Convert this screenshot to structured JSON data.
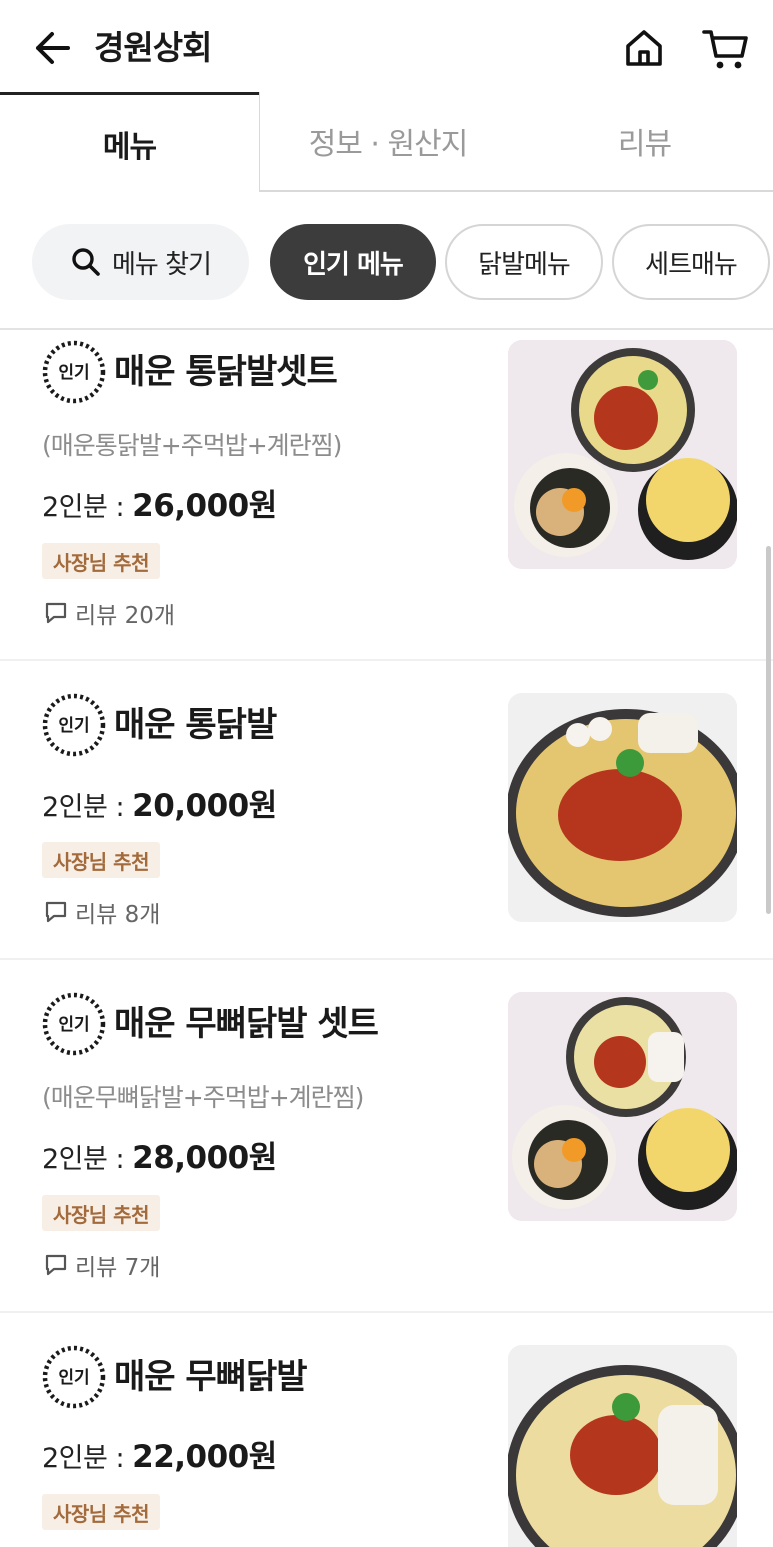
{
  "header": {
    "title": "경원상회",
    "back_icon": "arrow-left-icon",
    "home_icon": "home-icon",
    "cart_icon": "cart-icon"
  },
  "tabs": [
    {
      "label": "메뉴",
      "active": true
    },
    {
      "label": "정보 · 원산지",
      "active": false
    },
    {
      "label": "리뷰",
      "active": false
    }
  ],
  "chips": {
    "search_label": "메뉴 찾기",
    "popular_label": "인기 메뉴",
    "feet_label": "닭발메뉴",
    "set_label": "세트매뉴"
  },
  "badge_text": "인기",
  "items": [
    {
      "name": "매운 통닭발셋트",
      "desc": "(매운통닭발+주먹밥+계란찜)",
      "price_label": "2인분 : ",
      "price": "26,000원",
      "tag": "사장님 추천",
      "review": "리뷰 20개"
    },
    {
      "name": "매운 통닭발",
      "price_label": "2인분 : ",
      "price": "20,000원",
      "tag": "사장님 추천",
      "review": "리뷰 8개"
    },
    {
      "name": "매운 무뼈닭발 셋트",
      "desc": "(매운무뼈닭발+주먹밥+계란찜)",
      "price_label": "2인분 : ",
      "price": "28,000원",
      "tag": "사장님 추천",
      "review": "리뷰 7개"
    },
    {
      "name": "매운 무뼈닭발",
      "price_label": "2인분 : ",
      "price": "22,000원",
      "tag": "사장님 추천"
    }
  ],
  "colors": {
    "accent_dark": "#3c3c3c",
    "tag_bg": "#f7efe6",
    "tag_text": "#a36a3b"
  }
}
